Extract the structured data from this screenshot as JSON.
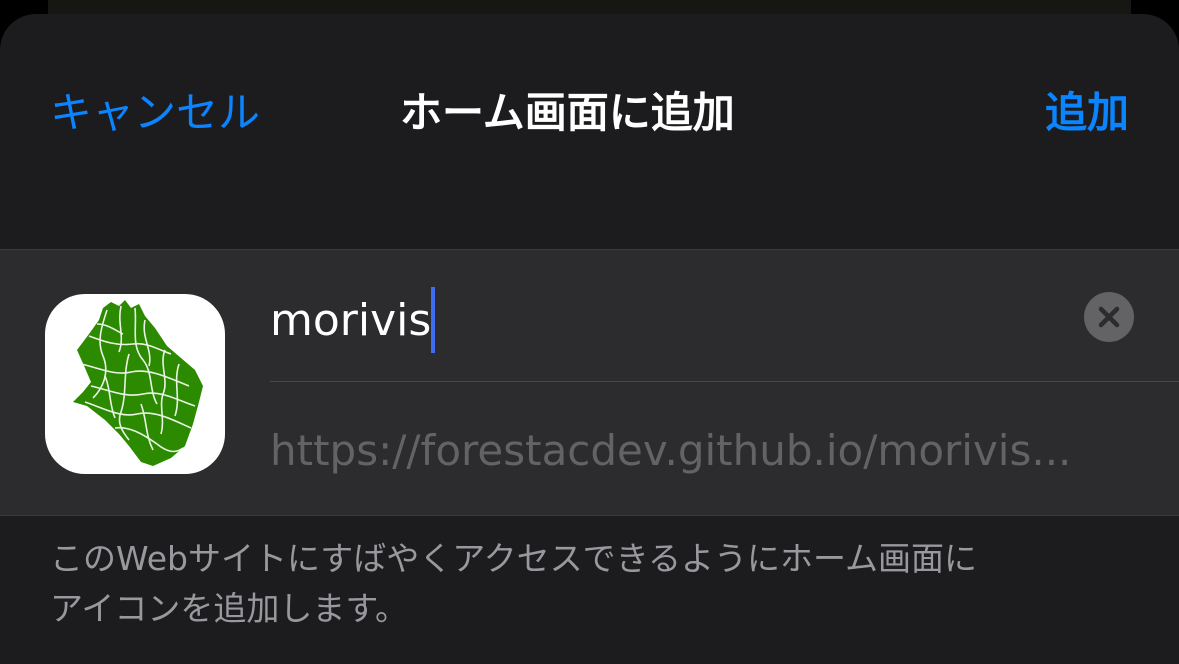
{
  "navigation": {
    "cancel_label": "キャンセル",
    "title": "ホーム画面に追加",
    "add_label": "追加"
  },
  "bookmark": {
    "name_value": "morivis",
    "url": "https://forestacdev.github.io/morivis..."
  },
  "footer": {
    "line1": "このWebサイトにすばやくアクセスできるようにホーム画面に",
    "line2": "アイコンを追加します。"
  },
  "icons": {
    "app_icon": "forest-map-icon",
    "clear": "clear-circle-icon"
  },
  "colors": {
    "accent": "#0a84ff",
    "sheet_background": "#1c1c1e",
    "group_background": "#2c2c2e",
    "icon_green": "#2b8a00"
  }
}
